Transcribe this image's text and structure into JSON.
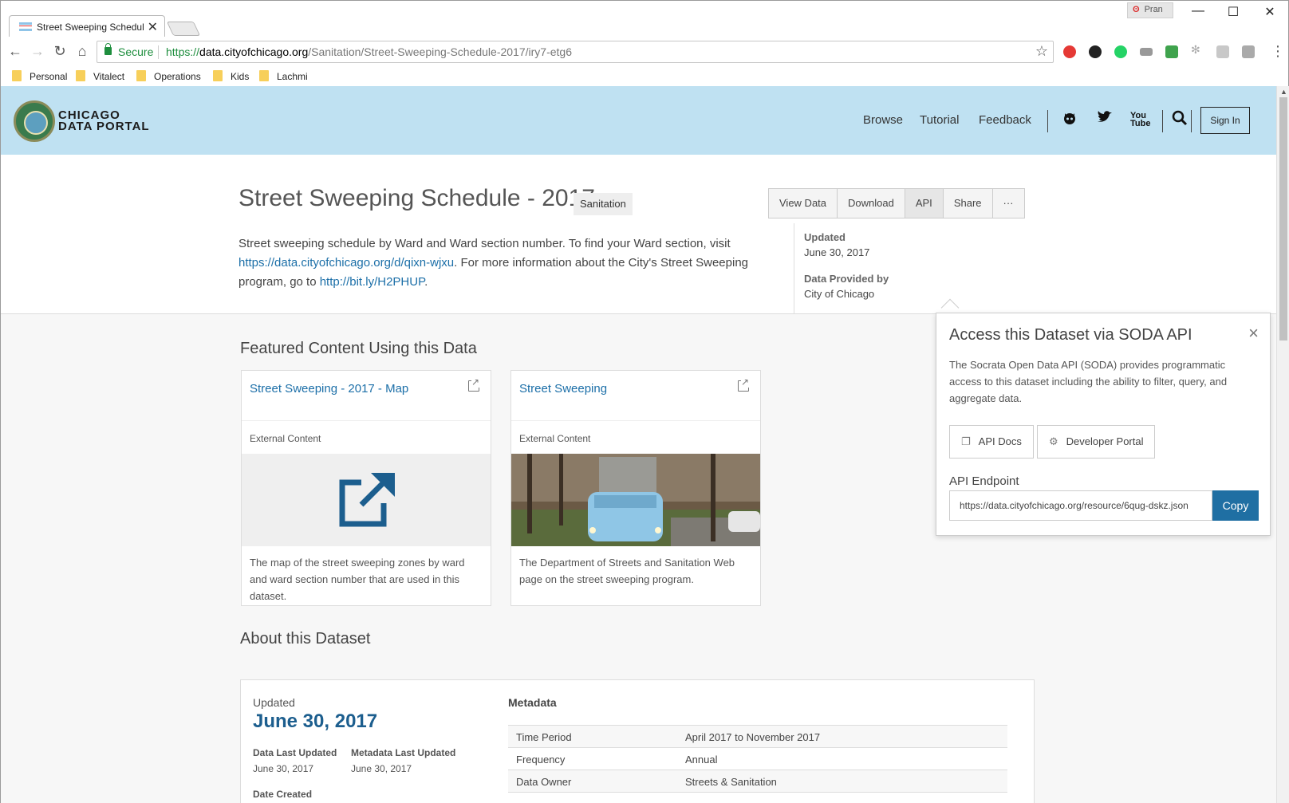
{
  "browser": {
    "tab_title": "Street Sweeping Schedul",
    "tab_close": "✕",
    "profile_name": "Pran",
    "url_proto": "https://",
    "url_host": "data.cityofchicago.org",
    "url_path": "/Sanitation/Street-Sweeping-Schedule-2017/iry7-etg6",
    "secure_label": "Secure",
    "bookmarks": [
      "Personal",
      "Vitalect",
      "Operations",
      "Kids",
      "Lachmi"
    ],
    "accent_secure": "#1e8e3e"
  },
  "header": {
    "logo_line1": "CHICAGO",
    "logo_line2": "DATA PORTAL",
    "nav": [
      "Browse",
      "Tutorial",
      "Feedback"
    ],
    "sign_in": "Sign In",
    "background": "#bfe1f2"
  },
  "dataset": {
    "title": "Street Sweeping Schedule - 2017",
    "category": "Sanitation",
    "actions": [
      "View Data",
      "Download",
      "API",
      "Share",
      "···"
    ],
    "desc_part1": "Street sweeping schedule by Ward and Ward section number. To find your Ward section, visit ",
    "desc_link1": "https://data.cityofchicago.org/d/qixn-wjxu",
    "desc_part2": ". For more information about the City's Street Sweeping program, go to ",
    "desc_link2": "http://bit.ly/H2PHUP",
    "desc_part3": ".",
    "updated_label": "Updated",
    "updated_value": "June 30, 2017",
    "provided_label": "Data Provided by",
    "provided_value": "City of Chicago"
  },
  "featured": {
    "heading": "Featured Content Using this Data",
    "cards": [
      {
        "title": "Street Sweeping - 2017 - Map",
        "type": "External Content",
        "desc": "The map of the street sweeping zones by ward and ward section number that are used in this dataset."
      },
      {
        "title": "Street Sweeping",
        "type": "External Content",
        "desc": "The Department of Streets and Sanitation Web page on the street sweeping program."
      }
    ]
  },
  "about": {
    "heading": "About this Dataset",
    "updated_label": "Updated",
    "updated_value": "June 30, 2017",
    "data_last_updated_label": "Data Last Updated",
    "data_last_updated_value": "June 30, 2017",
    "metadata_last_updated_label": "Metadata Last Updated",
    "metadata_last_updated_value": "June 30, 2017",
    "date_created_label": "Date Created",
    "metadata_heading": "Metadata",
    "rows": [
      {
        "key": "Time Period",
        "value": "April 2017 to November 2017"
      },
      {
        "key": "Frequency",
        "value": "Annual"
      },
      {
        "key": "Data Owner",
        "value": "Streets & Sanitation"
      }
    ]
  },
  "api_popover": {
    "title": "Access this Dataset via SODA API",
    "desc": "The Socrata Open Data API (SODA) provides programmatic access to this dataset including the ability to filter, query, and aggregate data.",
    "api_docs": "API Docs",
    "developer_portal": "Developer Portal",
    "endpoint_label": "API Endpoint",
    "endpoint_value": "https://data.cityofchicago.org/resource/6qug-dskz.json",
    "copy": "Copy",
    "copy_color": "#1f6fa3"
  }
}
